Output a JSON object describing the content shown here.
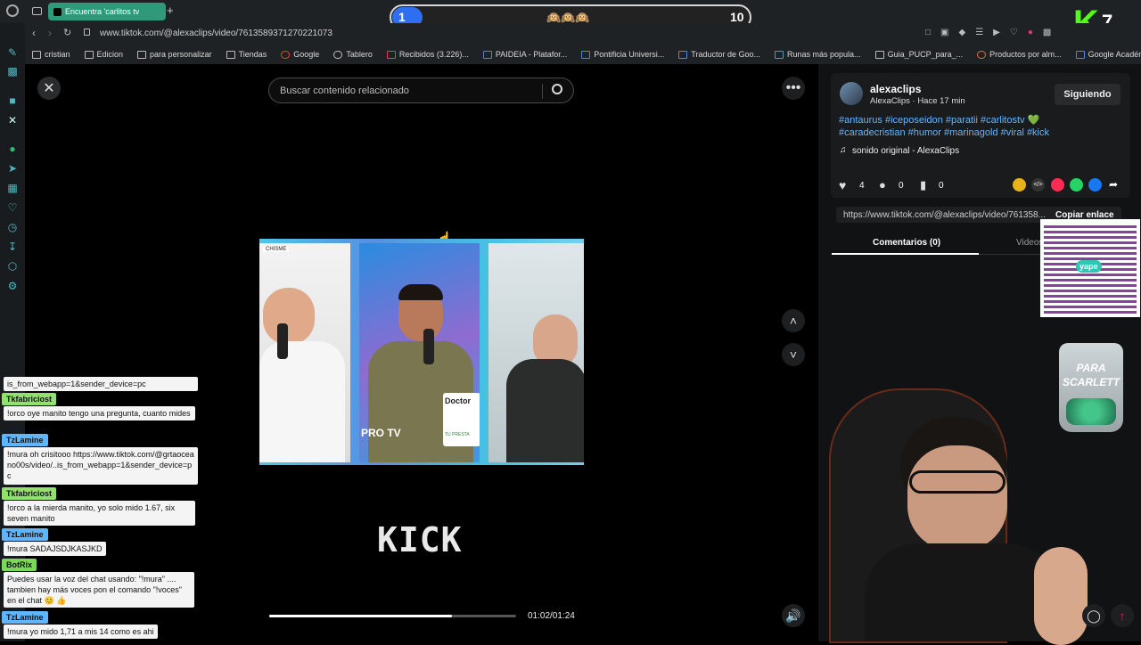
{
  "browser": {
    "tab_title": "Encuentra 'carlitos tv",
    "new_tab": "+",
    "url": "www.tiktok.com/@alexaclips/video/7613589371270221073",
    "bookmarks": [
      "cristian",
      "Edicion",
      "para personalizar",
      "Tiendas",
      "Google",
      "Tablero",
      "Recibidos (3.226)...",
      "PAIDEIA - Platafor...",
      "Pontificia Universi...",
      "Traductor de Goo...",
      "Runas más popula...",
      "Guia_PUCP_para_...",
      "Productos por alm...",
      "Google Académico"
    ]
  },
  "scoreboard": {
    "left": "1",
    "right": "10",
    "emojis": "🙉🙉🙉"
  },
  "k_badge": {
    "letter": "K",
    "number": "7"
  },
  "tiktok": {
    "search_placeholder": "Buscar contenido relacionado",
    "author_handle": "alexaclips",
    "author_meta": "AlexaClips · Hace 17 min",
    "follow_label": "Siguiendo",
    "hashtags": "#antaurus #iceposeidon #paratii #carlitostv 💚 #caradecristian #humor #marinagold #viral #kick",
    "sound": "sonido original - AlexaClips",
    "likes": "4",
    "comments": "0",
    "saves": "0",
    "share_url": "https://www.tiktok.com/@alexaclips/video/761358...",
    "copy_link": "Copiar enlace",
    "tab_comments": "Comentarios (0)",
    "tab_videos": "Videos",
    "time": "01:02/01:24",
    "progress": 0.74,
    "kick_logo": "KICK",
    "video_caption_top": "CHISME",
    "video_caption_bottom": "TU PRESTA",
    "video_brand": "PRO TV",
    "doctor": "Doctor"
  },
  "yape": "yape",
  "jar_label": "PARA SCARLETT",
  "chat": [
    {
      "user": "",
      "text": "is_from_webapp=1&sender_device=pc"
    },
    {
      "user": "Tkfabriciost",
      "text": "!orco oye manito tengo una pregunta, cuanto mides"
    },
    {
      "user": "TzLamine",
      "text": "!mura oh crisitooo https://www.tiktok.com/@grtaoceano00s/video/..is_from_webapp=1&sender_device=pc"
    },
    {
      "user": "Tkfabriciost",
      "text": "!orco a la mierda manito, yo solo mido 1.67, six seven manito"
    },
    {
      "user": "TzLamine",
      "text": "!mura SADAJSDJKASJKD"
    },
    {
      "user": "BotRix",
      "text": "Puedes usar la voz del chat usando: \"!mura\" .... tambien hay más voces pon el comando \"!voces\" en el chat 😊 👍"
    },
    {
      "user": "TzLamine",
      "text": "!mura yo mido 1,71 a mis 14 como es ahi"
    }
  ],
  "colors": {
    "user_green": "#8fe36b",
    "user_blue": "#5fb6ff",
    "user_botrix": "#7ad957",
    "tab_green": "#2f9a7a"
  }
}
